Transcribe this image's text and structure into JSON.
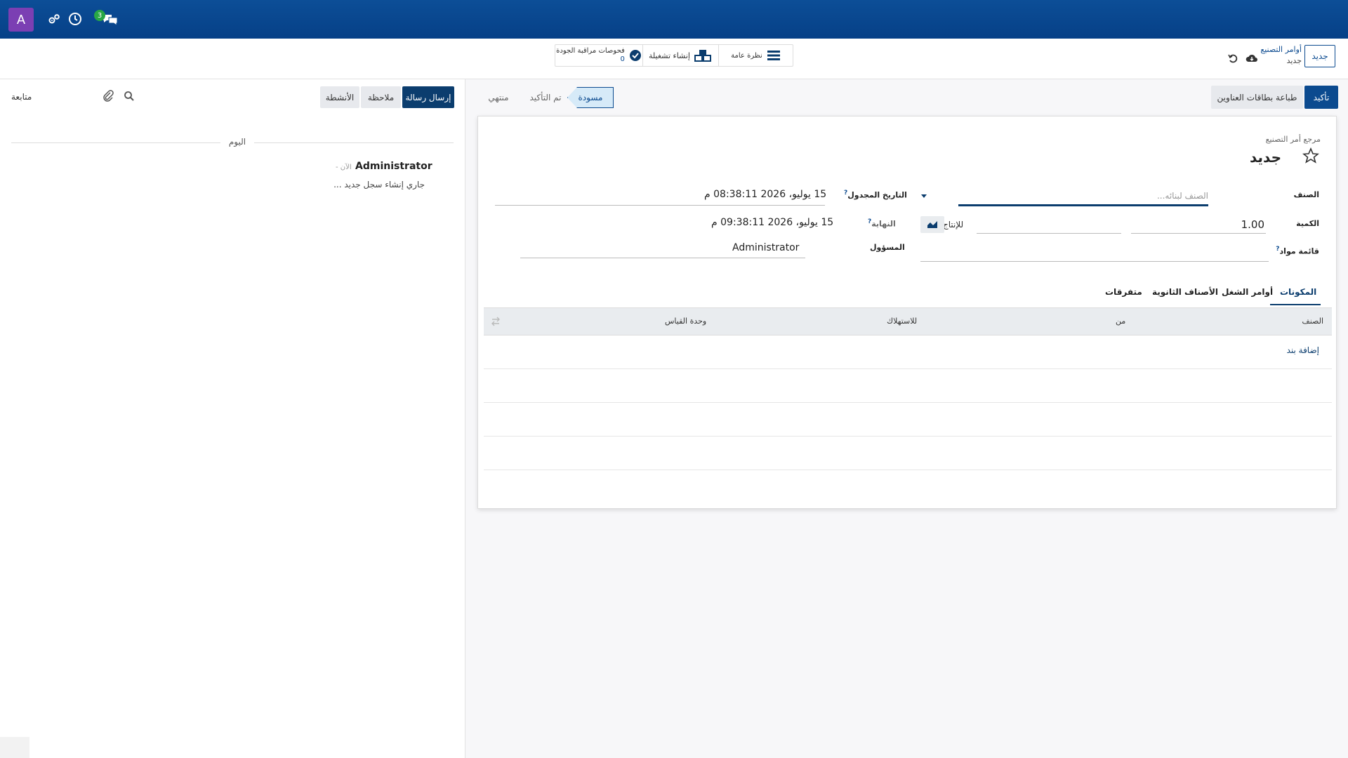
{
  "navbar": {
    "avatar_letter": "A",
    "chat_count": "3"
  },
  "control": {
    "new_button": "جديد",
    "breadcrumb_parent": "أوامر التصنيع",
    "breadcrumb_current": "جديد",
    "smart_buttons": {
      "overview": "نظرة عامة",
      "create_operation": "إنشاء تشغيلة",
      "quality_checks_label": "فحوصات مراقبة الجودة",
      "quality_checks_count": "0"
    }
  },
  "statusbar": {
    "confirm": "تأكيد",
    "print_labels": "طباعة بطاقات العناوين",
    "stages": [
      "مسودة",
      "تم التأكيد",
      "منتهي"
    ]
  },
  "chatter": {
    "send_message": "إرسال رسالة",
    "log_note": "ملاحظة",
    "activities": "الأنشطة",
    "follow": "متابعة",
    "date_separator": "اليوم",
    "message_author": "Administrator",
    "message_time": "- الآن",
    "message_body": "جاري إنشاء سجل جديد ..."
  },
  "form": {
    "reference_label": "مرجع أمر التصنيع",
    "title": "جديد",
    "product_label": "الصنف",
    "product_placeholder": "الصنف لبنائه...",
    "quantity_label": "الكمية",
    "quantity_value": "1.00",
    "to_produce": "للإنتاج",
    "bom_label": "قائمة مواد",
    "scheduled_date_label": "التاريخ المجدول",
    "scheduled_date_value": "15 يوليو، 2026 08:38:11 م",
    "end_label": "النهاية",
    "end_value": "15 يوليو، 2026 09:38:11 م",
    "responsible_label": "المسؤول",
    "responsible_value": "Administrator",
    "help_mark": "?"
  },
  "tabs": [
    "المكونات",
    "أوامر الشغل",
    "الأصناف الثانوية",
    "متفرقات"
  ],
  "table": {
    "columns": [
      "الصنف",
      "من",
      "للاستهلاك",
      "وحدة القياس"
    ],
    "add_line": "إضافة بند"
  }
}
